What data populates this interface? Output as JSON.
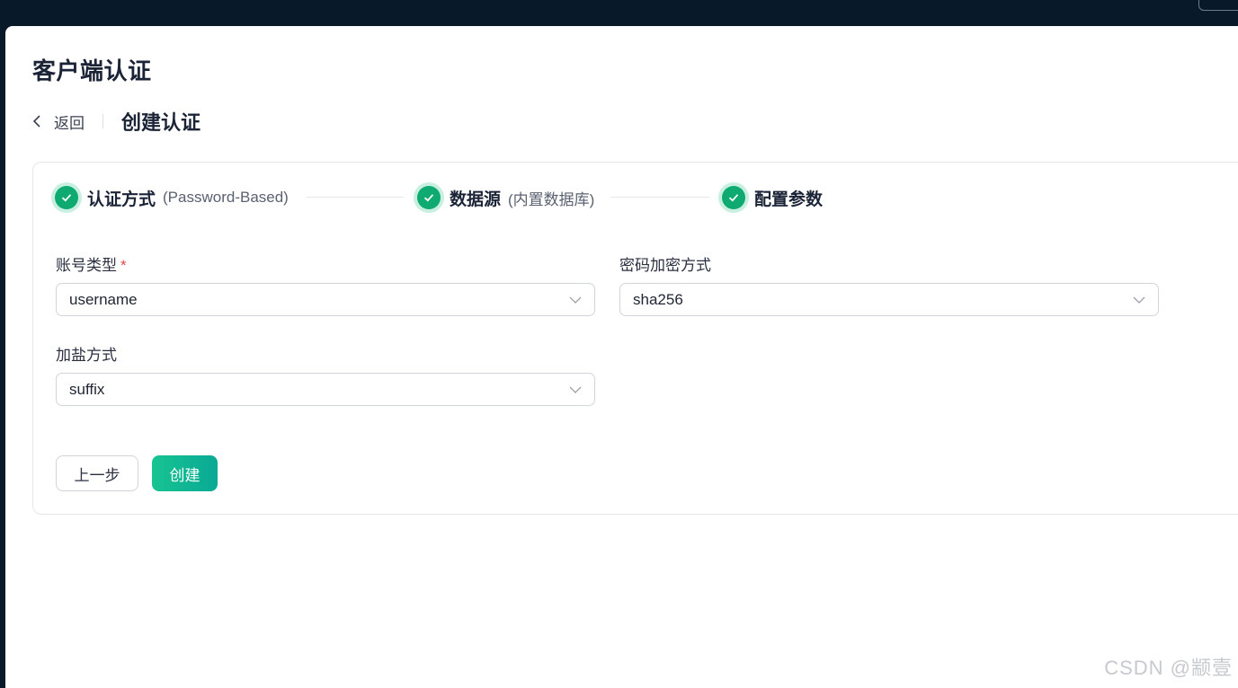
{
  "page": {
    "title": "客户端认证",
    "back_label": "返回",
    "subtitle": "创建认证"
  },
  "steps": [
    {
      "label": "认证方式",
      "sub": "(Password-Based)",
      "status": "done"
    },
    {
      "label": "数据源",
      "sub": "(内置数据库)",
      "status": "done"
    },
    {
      "label": "配置参数",
      "sub": "",
      "status": "done"
    }
  ],
  "form": {
    "account_type": {
      "label": "账号类型",
      "required_mark": "*",
      "value": "username"
    },
    "password_hash": {
      "label": "密码加密方式",
      "value": "sha256"
    },
    "salt_position": {
      "label": "加盐方式",
      "value": "suffix"
    }
  },
  "buttons": {
    "prev": "上一步",
    "create": "创建"
  },
  "watermark": "CSDN @颛壹",
  "colors": {
    "accent": "#0fa972",
    "topbar": "#081a2a",
    "required": "#e5484d"
  }
}
